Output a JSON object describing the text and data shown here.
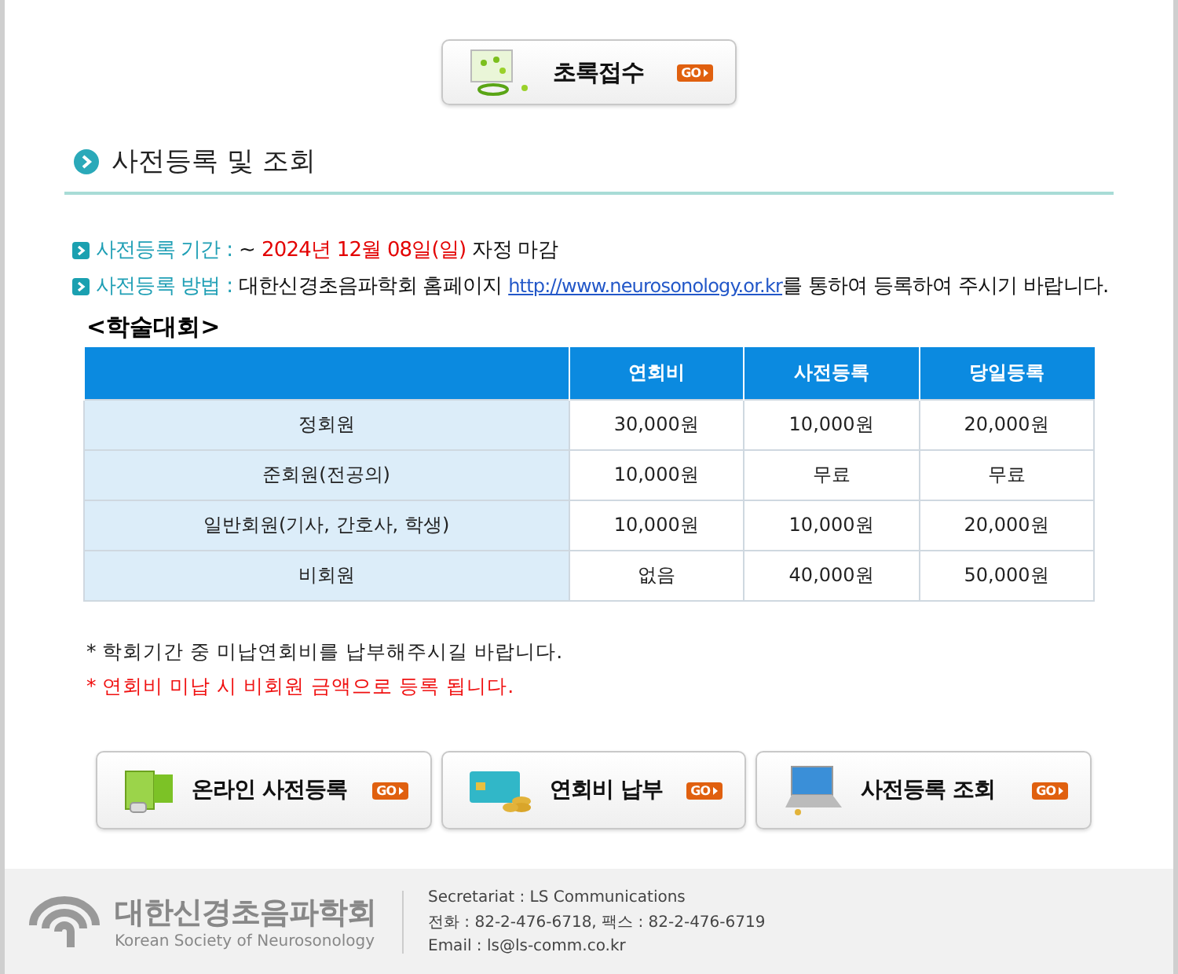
{
  "top_button": {
    "label": "초록접수",
    "badge": "GO"
  },
  "section": {
    "title": "사전등록 및 조회"
  },
  "info": [
    {
      "segments": [
        {
          "kind": "label",
          "text": "사전등록 기간 :"
        },
        {
          "kind": "plain",
          "text": "~"
        },
        {
          "kind": "highlight",
          "text": "2024년 12월 08일(일)"
        },
        {
          "kind": "plain",
          "text": "자정 마감"
        }
      ]
    },
    {
      "segments": [
        {
          "kind": "label",
          "text": "사전등록 방법 :"
        },
        {
          "kind": "plain",
          "text": "대한신경초음파학회 홈페이지"
        },
        {
          "kind": "link",
          "text": "http://www.neurosonology.or.kr"
        },
        {
          "kind": "attached",
          "text": "를 통하여 등록하여 주시기 바랍니다."
        }
      ]
    }
  ],
  "table": {
    "heading": "<학술대회>",
    "columns": [
      "",
      "연회비",
      "사전등록",
      "당일등록"
    ],
    "rows": [
      [
        "정회원",
        "30,000원",
        "10,000원",
        "20,000원"
      ],
      [
        "준회원(전공의)",
        "10,000원",
        "무료",
        "무료"
      ],
      [
        "일반회원(기사, 간호사, 학생)",
        "10,000원",
        "10,000원",
        "20,000원"
      ],
      [
        "비회원",
        "없음",
        "40,000원",
        "50,000원"
      ]
    ]
  },
  "notes": [
    {
      "text": "* 학회기간 중 미납연회비를 납부해주시길 바랍니다.",
      "warning": false
    },
    {
      "text": "* 연회비 미납 시 비회원 금액으로 등록 됩니다.",
      "warning": true
    }
  ],
  "buttons": [
    {
      "kind": "monitor",
      "label": "온라인 사전등록",
      "badge": "GO"
    },
    {
      "kind": "card",
      "label": "연회비 납부",
      "badge": "GO"
    },
    {
      "kind": "laptop",
      "label": "사전등록 조회",
      "badge": "GO"
    }
  ],
  "footer": {
    "logo_name": "대한신경초음파학회",
    "logo_subtitle": "Korean Society of Neurosonology",
    "lines": [
      "Secretariat : LS Communications",
      "전화 : 82-2-476-6718, 팩스 : 82-2-476-6719",
      "Email : ls@ls-comm.co.kr"
    ]
  }
}
